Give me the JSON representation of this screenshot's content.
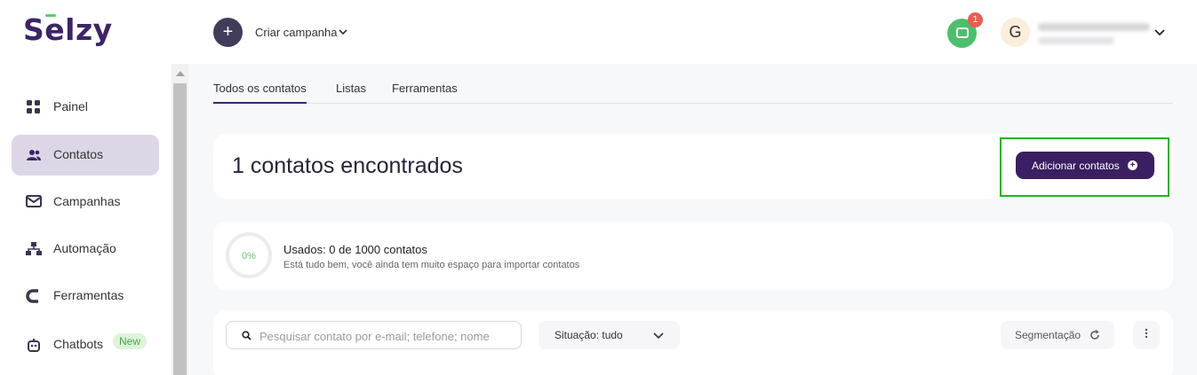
{
  "header": {
    "logo_text": "Selzy",
    "create_campaign_label": "Criar campanha",
    "create_button_symbol": "+",
    "notification_count": "1",
    "avatar_initial": "G"
  },
  "sidebar": {
    "items": [
      {
        "label": "Painel",
        "icon": "grid-icon"
      },
      {
        "label": "Contatos",
        "icon": "users-icon",
        "active": true
      },
      {
        "label": "Campanhas",
        "icon": "mail-icon"
      },
      {
        "label": "Automação",
        "icon": "flow-icon"
      },
      {
        "label": "Ferramentas",
        "icon": "magnet-icon"
      },
      {
        "label": "Chatbots",
        "icon": "robot-icon",
        "badge": "New"
      }
    ]
  },
  "main": {
    "tabs": [
      {
        "label": "Todos os contatos",
        "active": true
      },
      {
        "label": "Listas"
      },
      {
        "label": "Ferramentas"
      }
    ],
    "found_title": "1 contatos encontrados",
    "add_contacts_label": "Adicionar contatos",
    "usage": {
      "percent_label": "0%",
      "percent": 0,
      "title": "Usados: 0 de 1000 contatos",
      "subtitle": "Está tudo bem, você ainda tem muito espaço para importar contatos"
    },
    "filters": {
      "search_placeholder": "Pesquisar contato por e-mail; telefone; nome",
      "status_label": "Situação: tudo",
      "segmentation_label": "Segmentação"
    }
  },
  "colors": {
    "brand": "#3d2468",
    "accent_green": "#4cbf6c",
    "badge_red": "#ef5b4f",
    "highlight_border": "#1fb51f"
  }
}
